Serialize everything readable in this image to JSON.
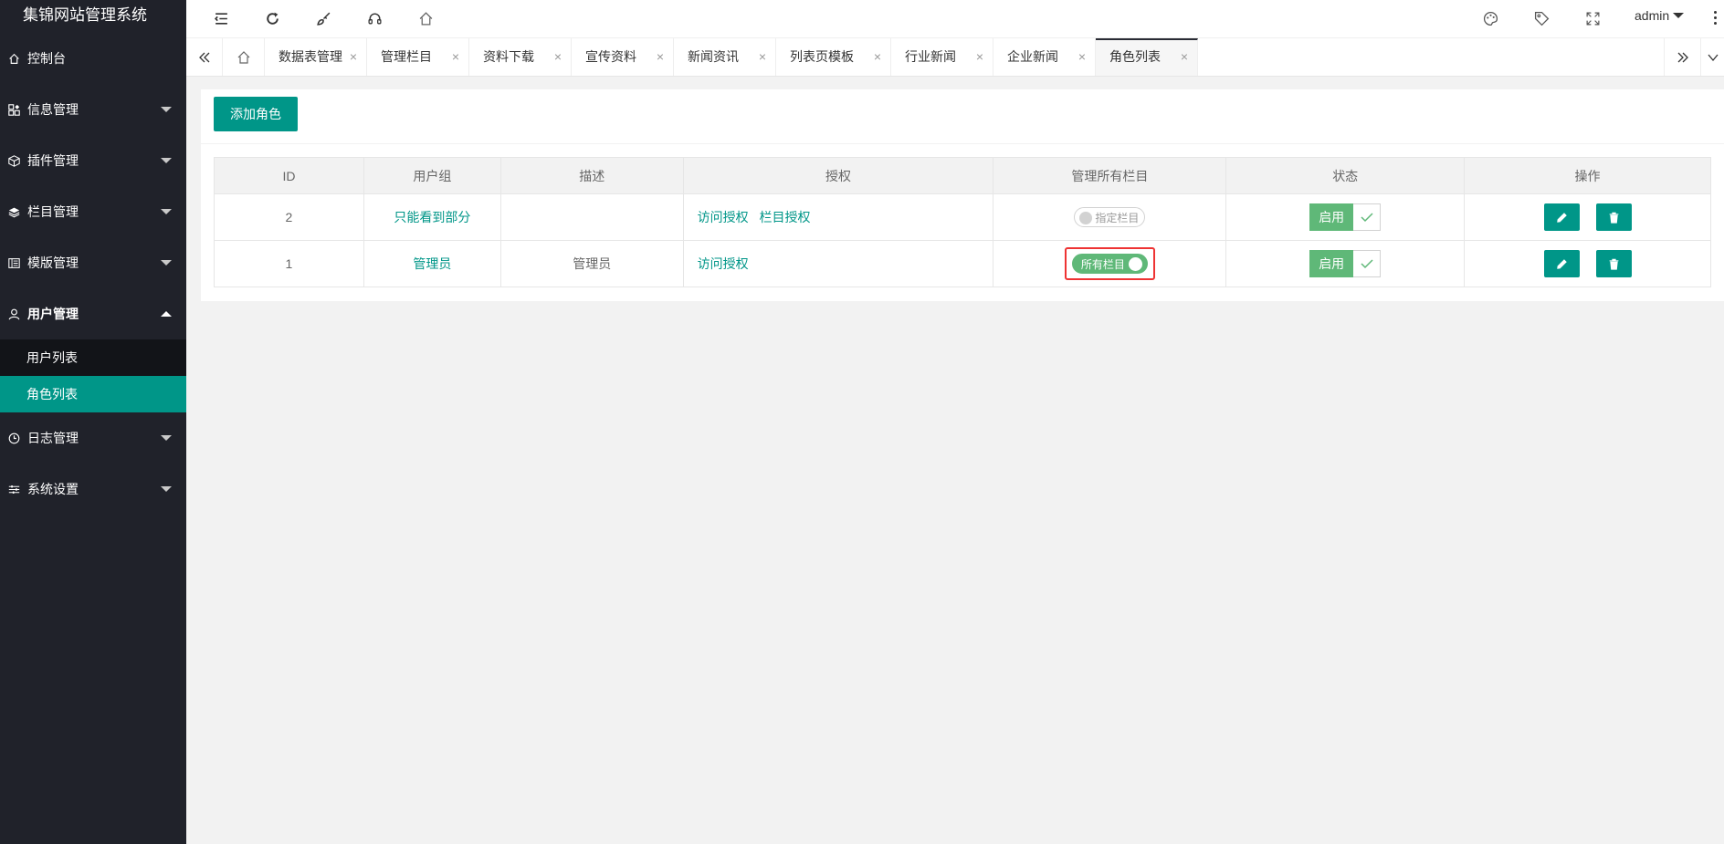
{
  "app": {
    "title": "集锦网站管理系统"
  },
  "sidebar": {
    "items": [
      {
        "label": "控制台",
        "icon": "home-icon",
        "has_caret": false
      },
      {
        "label": "信息管理",
        "icon": "apps-icon",
        "has_caret": true
      },
      {
        "label": "插件管理",
        "icon": "cube-icon",
        "has_caret": true
      },
      {
        "label": "栏目管理",
        "icon": "layers-icon",
        "has_caret": true
      },
      {
        "label": "模版管理",
        "icon": "template-icon",
        "has_caret": true
      },
      {
        "label": "用户管理",
        "icon": "user-icon",
        "has_caret": true,
        "open": true
      },
      {
        "label": "日志管理",
        "icon": "clock-icon",
        "has_caret": true
      },
      {
        "label": "系统设置",
        "icon": "sliders-icon",
        "has_caret": true
      }
    ],
    "subitems": [
      {
        "label": "用户列表",
        "active": false
      },
      {
        "label": "角色列表",
        "active": true
      }
    ]
  },
  "header": {
    "icons": [
      "menu-shrink-icon",
      "refresh-icon",
      "brush-icon",
      "headset-icon",
      "home-icon",
      "theme-icon",
      "tag-icon",
      "fullscreen-icon"
    ],
    "user": "admin"
  },
  "tabs": {
    "items": [
      {
        "label": "数据表管理"
      },
      {
        "label": "管理栏目"
      },
      {
        "label": "资料下载"
      },
      {
        "label": "宣传资料"
      },
      {
        "label": "新闻资讯"
      },
      {
        "label": "列表页模板"
      },
      {
        "label": "行业新闻"
      },
      {
        "label": "企业新闻"
      },
      {
        "label": "角色列表",
        "active": true
      }
    ],
    "close": "×"
  },
  "toolbar": {
    "add_label": "添加角色"
  },
  "table": {
    "headers": [
      "ID",
      "用户组",
      "描述",
      "授权",
      "管理所有栏目",
      "状态",
      "操作"
    ],
    "rows": [
      {
        "id": "2",
        "group": "只能看到部分",
        "desc": "",
        "auth": [
          "访问授权",
          "栏目授权"
        ],
        "switch_label": "指定栏目",
        "switch_on": false,
        "status": "启用"
      },
      {
        "id": "1",
        "group": "管理员",
        "desc": "管理员",
        "auth": [
          "访问授权"
        ],
        "switch_label": "所有栏目",
        "switch_on": true,
        "status": "启用"
      }
    ]
  },
  "colors": {
    "accent": "#009688",
    "sidebar_bg": "#20222a",
    "success": "#5fb878",
    "highlight": "#ee3333"
  }
}
